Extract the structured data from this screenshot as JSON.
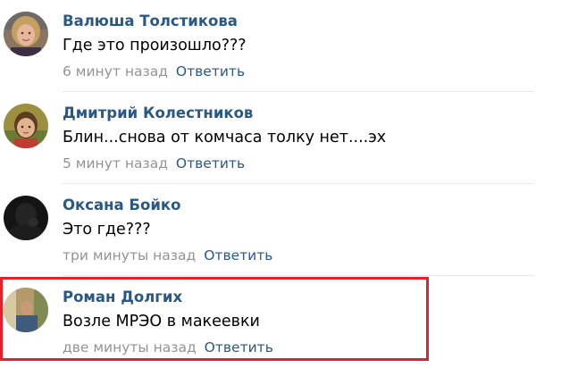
{
  "comments": [
    {
      "author": "Валюша Толстикова",
      "text": "Где это произошло???",
      "time": "6 минут назад",
      "reply_label": "Ответить",
      "avatar_icon": "avatar-photo-blonde-woman"
    },
    {
      "author": "Дмитрий Колестников",
      "text": "Блин...снова от комчаса толку нет....эх",
      "time": "5 минут назад",
      "reply_label": "Ответить",
      "avatar_icon": "avatar-photo-child"
    },
    {
      "author": "Оксана Бойко",
      "text": "Это где???",
      "time": "три минуты назад",
      "reply_label": "Ответить",
      "avatar_icon": "avatar-photo-dark"
    },
    {
      "author": "Роман Долгих",
      "text": "Возле МРЭО в макеевки",
      "time": "две минуты назад",
      "reply_label": "Ответить",
      "avatar_icon": "avatar-photo-outdoor-man"
    }
  ],
  "colors": {
    "author": "#2a5885",
    "reply": "#2a5885",
    "time": "#939393",
    "text": "#000000",
    "divider": "#e7e8ec",
    "highlight_border": "#e3202b"
  }
}
